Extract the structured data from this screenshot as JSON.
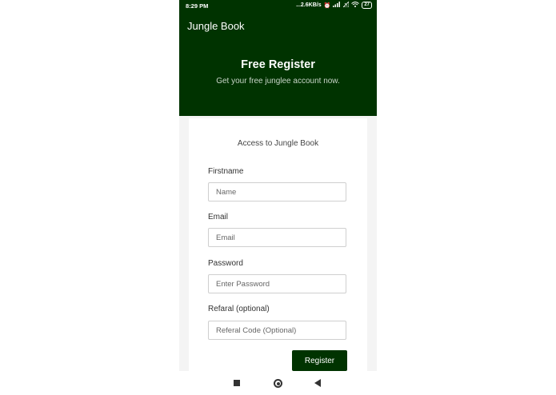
{
  "status_bar": {
    "time": "8:29 PM",
    "network_speed": "...2.6KB/s",
    "battery": "27"
  },
  "app_bar": {
    "title": "Jungle Book"
  },
  "header": {
    "title": "Free Register",
    "subtitle": "Get your free junglee account now."
  },
  "form": {
    "heading": "Access to Jungle Book",
    "fields": [
      {
        "label": "Firstname",
        "placeholder": "Name",
        "value": ""
      },
      {
        "label": "Email",
        "placeholder": "Email",
        "value": ""
      },
      {
        "label": "Password",
        "placeholder": "Enter Password",
        "value": ""
      },
      {
        "label": "Refaral (optional)",
        "placeholder": "Referal Code (Optional)",
        "value": ""
      }
    ],
    "submit_label": "Register"
  },
  "colors": {
    "primary": "#003300",
    "background": "#f4f4f4"
  },
  "nav": {
    "icons": [
      "recents-square-icon",
      "home-circle-icon",
      "back-triangle-icon"
    ]
  }
}
